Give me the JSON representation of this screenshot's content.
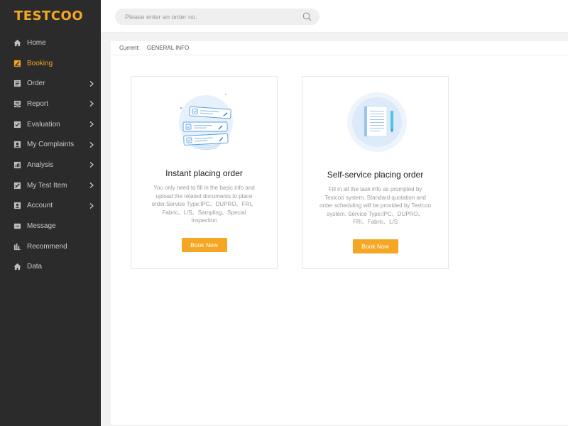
{
  "brand": {
    "logo": "TESTCOO",
    "accent": "#f5a623"
  },
  "search": {
    "placeholder": "Please enter an order no."
  },
  "sidebar": {
    "items": [
      {
        "label": "Home",
        "icon": "home-icon",
        "active": false,
        "expandable": false
      },
      {
        "label": "Booking",
        "icon": "booking-icon",
        "active": true,
        "expandable": false
      },
      {
        "label": "Order",
        "icon": "order-icon",
        "active": false,
        "expandable": true
      },
      {
        "label": "Report",
        "icon": "report-icon",
        "active": false,
        "expandable": true
      },
      {
        "label": "Evaluation",
        "icon": "evaluation-icon",
        "active": false,
        "expandable": true
      },
      {
        "label": "My Complaints",
        "icon": "complaints-icon",
        "active": false,
        "expandable": true
      },
      {
        "label": "Analysis",
        "icon": "analysis-icon",
        "active": false,
        "expandable": true
      },
      {
        "label": "My Test Item",
        "icon": "test-item-icon",
        "active": false,
        "expandable": true
      },
      {
        "label": "Account",
        "icon": "account-icon",
        "active": false,
        "expandable": true
      },
      {
        "label": "Message",
        "icon": "message-icon",
        "active": false,
        "expandable": false
      },
      {
        "label": "Recommend",
        "icon": "recommend-icon",
        "active": false,
        "expandable": false
      },
      {
        "label": "Data",
        "icon": "data-icon",
        "active": false,
        "expandable": false
      }
    ]
  },
  "breadcrumb": {
    "label": "Current:",
    "value": "GENERAL INFO"
  },
  "cards": [
    {
      "title": "Instant placing order",
      "description": "You only need to fill in the basic info and upload the related documents to place order.Service Type:IPC、DUPRO、FRI、Fabric、L/S、Sampling、Special Inspection",
      "button": "Book Now",
      "illustration": "order-forms-illustration"
    },
    {
      "title": "Self-service placing order",
      "description": "Fill in all the task info as prompted by Testcoo system. Standard quotation and order scheduling will be provided by Testcoo system. Service Type:IPC、DUPRO、FRI、Fabric、L/S",
      "button": "Book Now",
      "illustration": "notebook-pen-illustration"
    }
  ]
}
